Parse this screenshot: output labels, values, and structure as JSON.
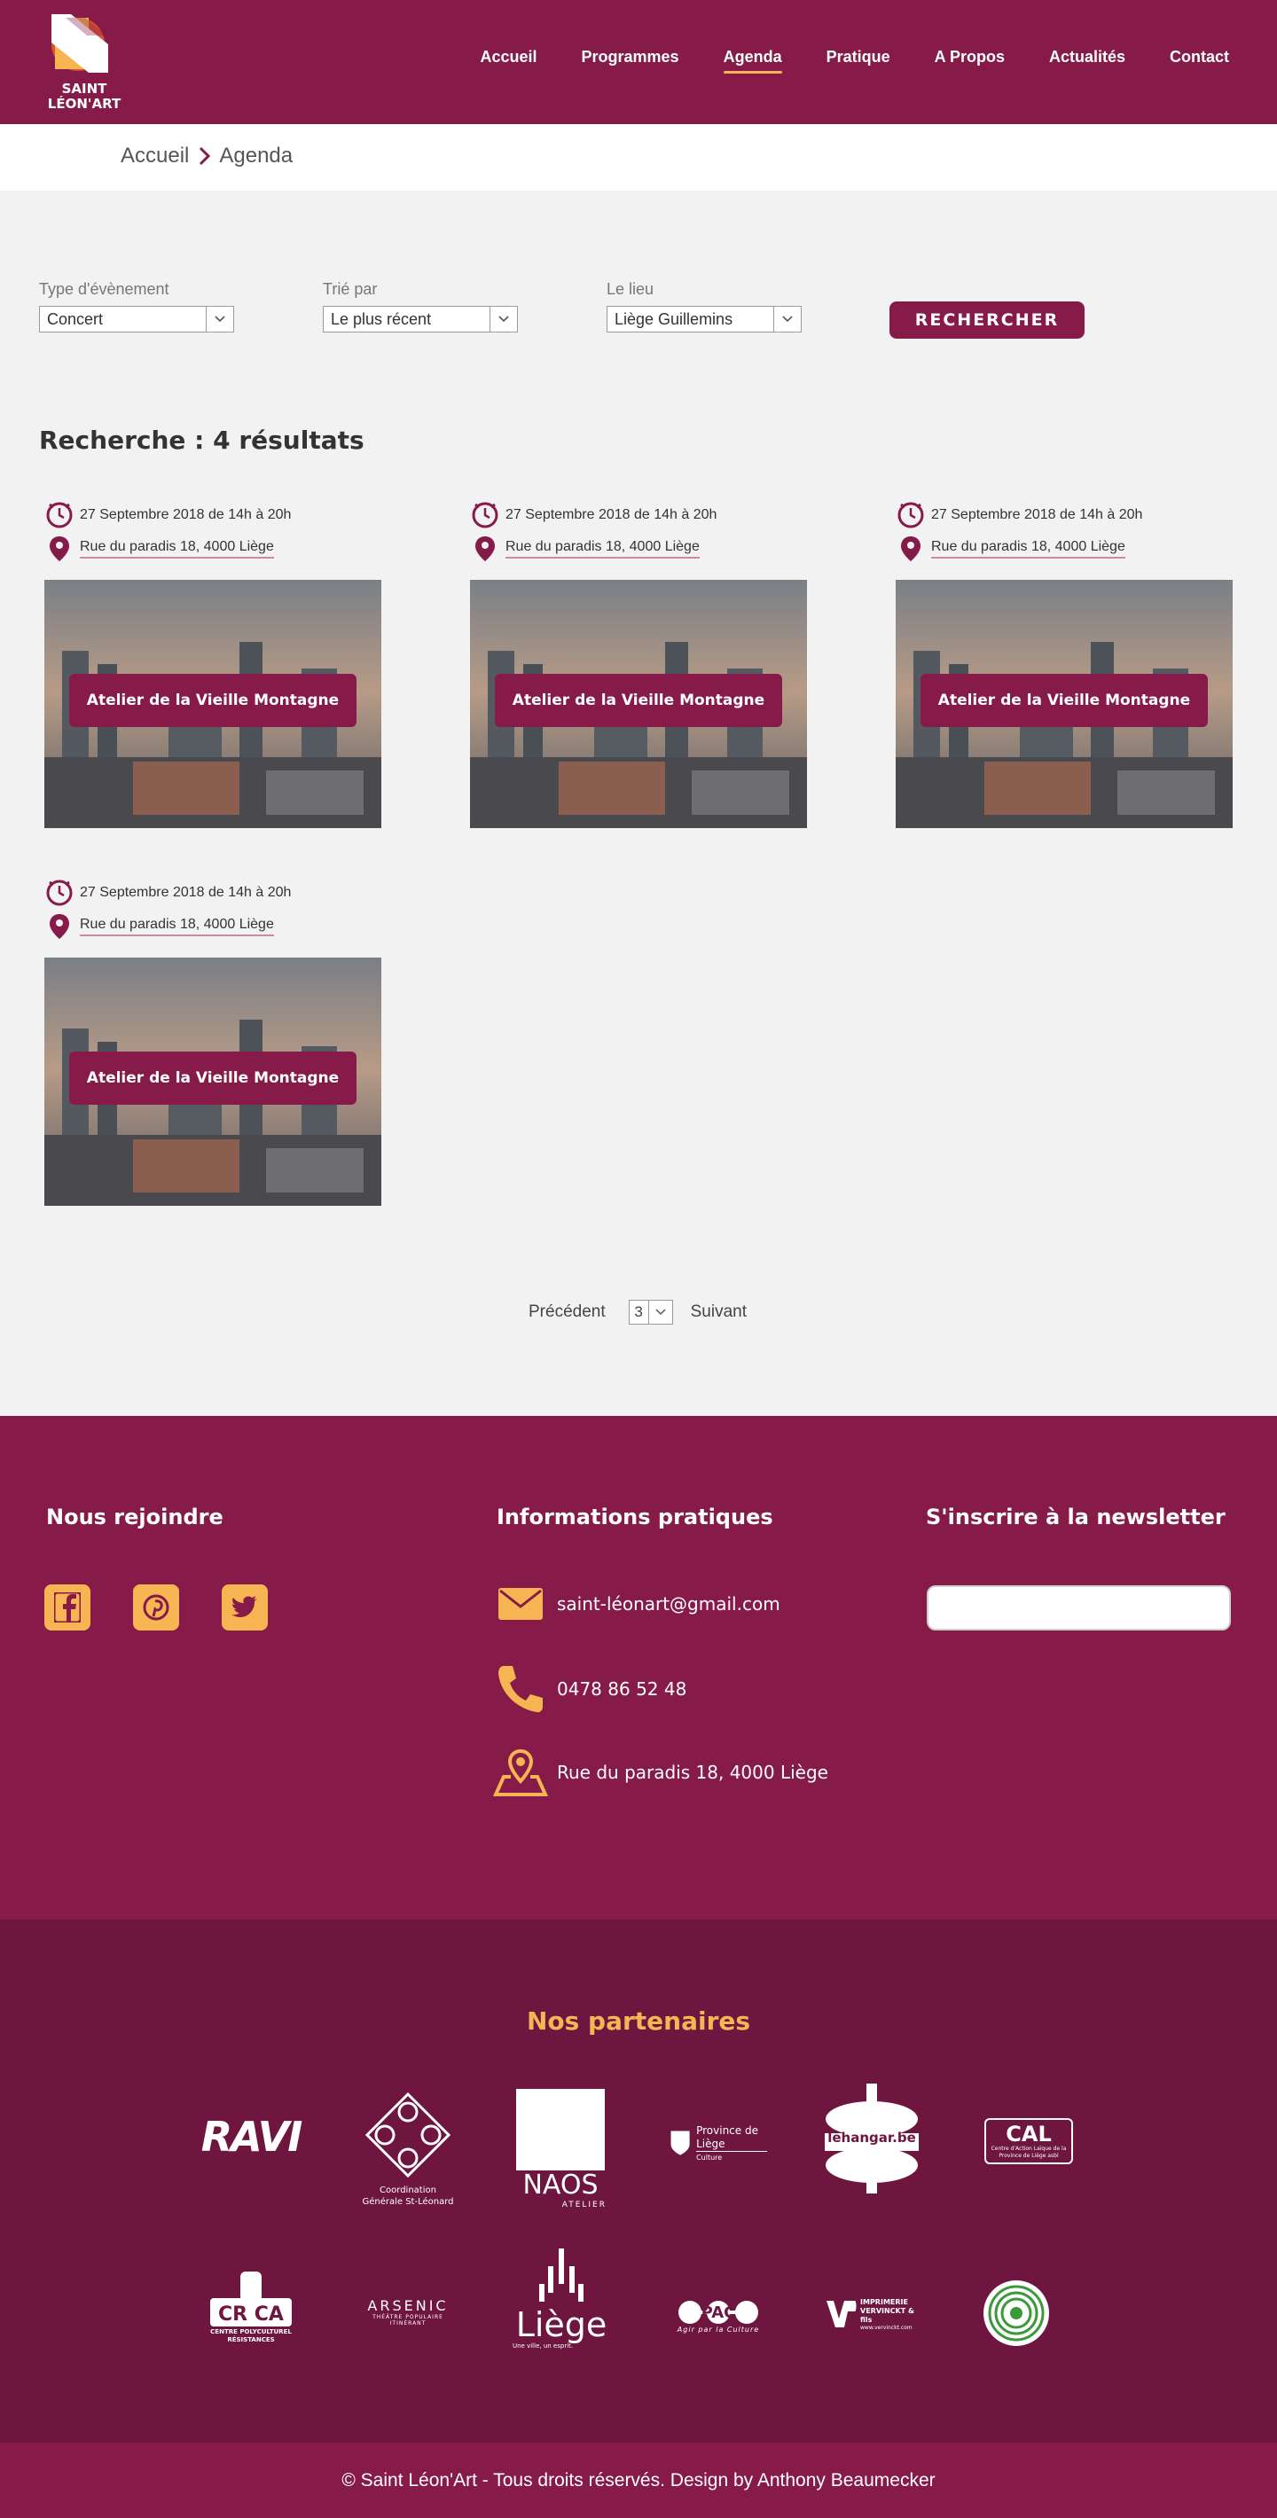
{
  "brand": {
    "logo_line1": "SAINT",
    "logo_line2": "LÉON'ART"
  },
  "nav": [
    {
      "label": "Accueil"
    },
    {
      "label": "Programmes"
    },
    {
      "label": "Agenda",
      "active": true
    },
    {
      "label": "Pratique"
    },
    {
      "label": "A Propos"
    },
    {
      "label": "Actualités"
    },
    {
      "label": "Contact"
    }
  ],
  "breadcrumb": {
    "home": "Accueil",
    "current": "Agenda"
  },
  "filters": {
    "type": {
      "label": "Type d'évènement",
      "value": "Concert"
    },
    "sort": {
      "label": "Trié par",
      "value": "Le plus récent"
    },
    "place": {
      "label": "Le lieu",
      "value": "Liège Guillemins"
    },
    "search_label": "RECHERCHER"
  },
  "results": {
    "title": "Recherche : 4 résultats",
    "items": [
      {
        "date": "27 Septembre 2018 de 14h à 20h",
        "address": "Rue du paradis 18, 4000 Liège",
        "title": "Atelier de la Vieille Montagne"
      },
      {
        "date": "27 Septembre 2018 de 14h à 20h",
        "address": "Rue du paradis 18, 4000 Liège",
        "title": "Atelier de la Vieille Montagne"
      },
      {
        "date": "27 Septembre 2018 de 14h à 20h",
        "address": "Rue du paradis 18, 4000 Liège",
        "title": "Atelier de la Vieille Montagne"
      },
      {
        "date": "27 Septembre 2018 de 14h à 20h",
        "address": "Rue du paradis 18, 4000 Liège",
        "title": "Atelier de la Vieille Montagne"
      }
    ]
  },
  "pagination": {
    "prev": "Précédent",
    "page": "3",
    "next": "Suivant"
  },
  "footer": {
    "join_title": "Nous rejoindre",
    "social": [
      "facebook-icon",
      "pinterest-icon",
      "twitter-icon"
    ],
    "info_title": "Informations pratiques",
    "email": "saint-léonart@gmail.com",
    "phone": "0478 86 52 48",
    "address": "Rue du paradis 18, 4000 Liège",
    "newsletter_title": "S'inscrire à la newsletter"
  },
  "partners": {
    "title": "Nos partenaires",
    "logos": [
      {
        "name": "RAVI"
      },
      {
        "name": "Coordination Générale St-Léonard"
      },
      {
        "name": "NAOS",
        "sub": "ATELIER"
      },
      {
        "name": "Province de Liège",
        "sub": "Culture"
      },
      {
        "name": "lehangar.be"
      },
      {
        "name": "CAL",
        "sub": "Centre d'Action Laïque de la Province de Liège asbl"
      },
      {
        "name": "CRACPA",
        "sub": "CENTRE POLYCULTUREL RÉSISTANCES"
      },
      {
        "name": "ARSENIC",
        "sub": "THÉÂTRE POPULAIRE ITINÉRANT"
      },
      {
        "name": "Liège",
        "sub": "Une ville, un esprit."
      },
      {
        "name": "PAC",
        "sub": "Agir par la Culture"
      },
      {
        "name": "IMPRIMERIE VERVINCKT & fils",
        "sub": "www.vervinckt.com"
      },
      {
        "name": "record-logo"
      }
    ]
  },
  "copyright": "© Saint Léon'Art - Tous droits réservés. Design by Anthony Beaumecker",
  "colors": {
    "primary": "#861b4a",
    "dark": "#6e1640",
    "accent": "#f6b552",
    "background": "#f2f2f2"
  }
}
